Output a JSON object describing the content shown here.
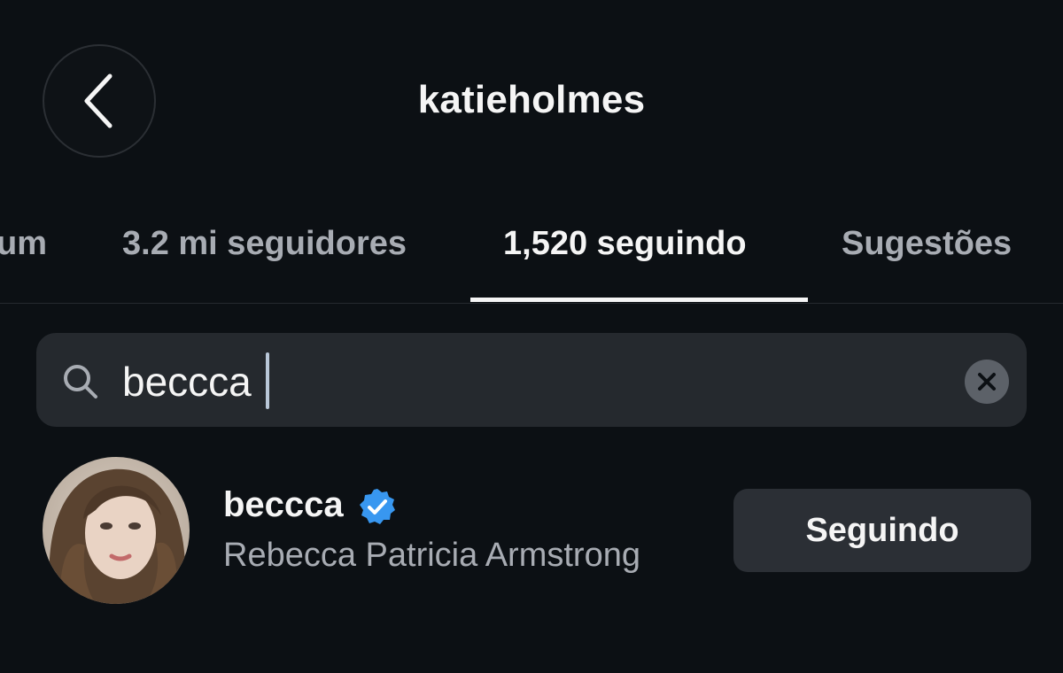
{
  "header": {
    "title": "katieholmes",
    "back_icon": "chevron-left-icon"
  },
  "tabs": [
    {
      "label": "um",
      "active": false
    },
    {
      "label": "3.2 mi seguidores",
      "active": false
    },
    {
      "label": "1,520 seguindo",
      "active": true
    },
    {
      "label": "Sugestões",
      "active": false
    }
  ],
  "search": {
    "value": "beccca",
    "icon": "search-icon",
    "clear_icon": "close-icon"
  },
  "results": [
    {
      "username": "beccca",
      "verified": true,
      "full_name": "Rebecca Patricia Armstrong",
      "button_label": "Seguindo"
    }
  ],
  "colors": {
    "background": "#0c1014",
    "verified_badge": "#3897f0",
    "button_bg": "#2b2f35",
    "search_bg": "#25292e",
    "secondary_text": "#a8acb3"
  }
}
